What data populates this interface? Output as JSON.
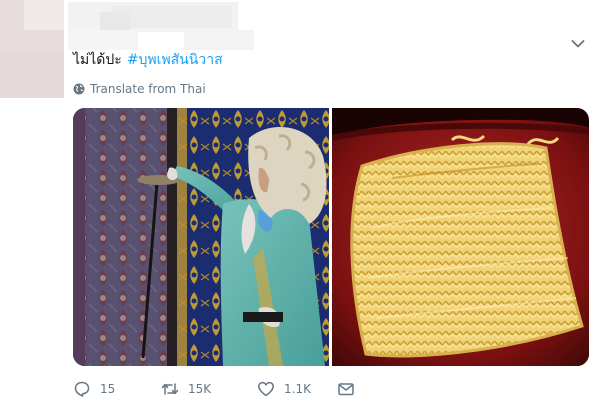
{
  "tweet": {
    "text": "ไม่ได้ปะ",
    "hashtag": "#บุพเพสันนิวาส",
    "translate_label": "Translate from Thai",
    "more_icon": "chevron-down-icon"
  },
  "media": {
    "photos": [
      {
        "subject": "costumed-figure"
      },
      {
        "subject": "instant-noodles"
      }
    ]
  },
  "actions": {
    "replies": "15",
    "retweets": "15K",
    "likes": "1.1K",
    "icons": [
      "reply-icon",
      "retweet-icon",
      "like-icon",
      "direct-message-icon"
    ]
  },
  "colors": {
    "link": "#1da1f2",
    "muted": "#657786",
    "text": "#14171a"
  }
}
